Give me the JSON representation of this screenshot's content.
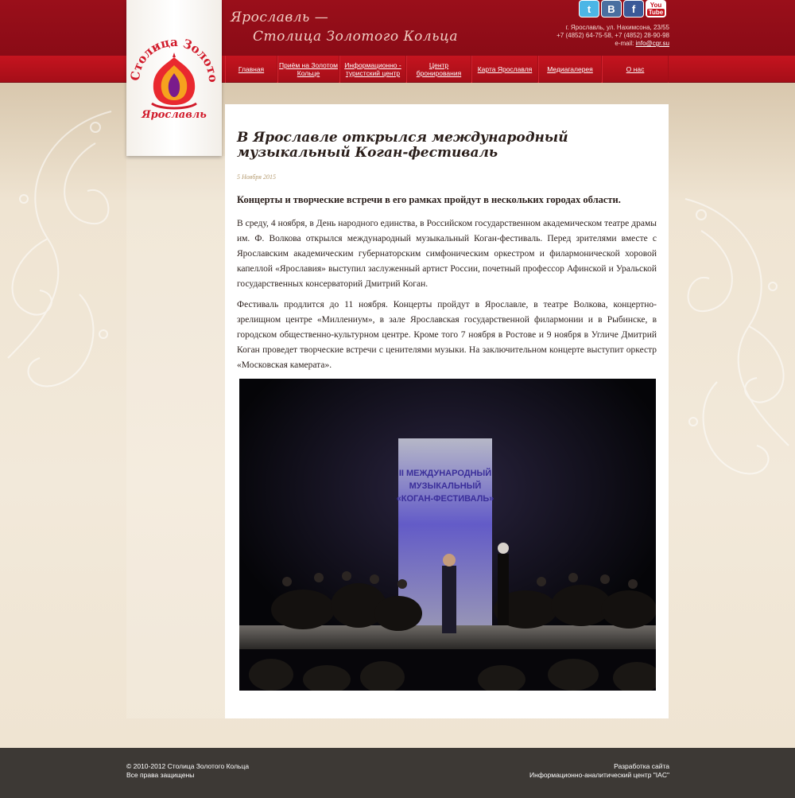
{
  "header": {
    "logo_text_top": "Столица Золотого Кольца",
    "logo_text_bottom": "Ярославль",
    "slogan_line1": "Ярославль —",
    "slogan_line2": "Столица Золотого Кольца",
    "social": [
      {
        "name": "twitter",
        "glyph": "t"
      },
      {
        "name": "vkontakte",
        "glyph": "B"
      },
      {
        "name": "facebook",
        "glyph": "f"
      },
      {
        "name": "youtube",
        "glyph_top": "You",
        "glyph_bottom": "Tube"
      }
    ],
    "address": "г. Ярославль, ул. Нахимсона, 23/55",
    "phones": "+7 (4852) 64-75-58, +7 (4852) 28-90-98",
    "email_label": "e-mail:",
    "email": "info@cgr.su"
  },
  "nav": {
    "items": [
      {
        "label": "Главная",
        "width": 0
      },
      {
        "label": "Приём на Золотом Кольце"
      },
      {
        "label": "Информационно - туристский центр"
      },
      {
        "label": "Центр бронирования"
      },
      {
        "label": "Карта Ярославля"
      },
      {
        "label": "Медиагалерея"
      },
      {
        "label": "О нас"
      }
    ]
  },
  "article": {
    "title": "В Ярославле открылся международный музыкальный Коган-фестиваль",
    "date": "5 Ноября 2015",
    "lead": "Концерты и творческие встречи в его рамках пройдут в нескольких городах области.",
    "paragraph1": "В среду, 4 ноября, в День народного единства, в Российском государственном академическом театре драмы им. Ф. Волкова открылся международный музыкальный Коган-фестиваль. Перед зрителями вместе с Ярославским академическим губернаторским симфоническим оркестром и филармонической хоровой капеллой «Ярославия» выступил заслуженный артист России, почетный профессор Афинской и Уральской государственных консерваторий Дмитрий Коган.",
    "paragraph2": "Фестиваль продлится до 11 ноября. Концерты пройдут в Ярославле, в театре Волкова, концертно-зрелищном центре «Миллениум», в зале Ярославская государственной филармонии и в Рыбинске, в городском общественно-культурном центре. Кроме того 7 ноября в Ростове и 9 ноября в Угличе Дмитрий Коган проведет творческие встречи с ценителями музыки. На заключительном концерте выступит оркестр «Московская камерата».",
    "photo_banner_line1": "II МЕЖДУНАРОДНЫЙ",
    "photo_banner_line2": "МУЗЫКАЛЬНЫЙ",
    "photo_banner_line3": "«КОГАН-ФЕСТИВАЛЬ»"
  },
  "footer": {
    "copyright": "© 2010-2012 Столица Золотого Кольца",
    "rights": "Все права защищены",
    "dev_label": "Разработка сайта",
    "dev_name": "Информационно-аналитический центр \"IAC\""
  },
  "colors": {
    "header_dark": "#9a0f1a",
    "nav_red": "#c5141f",
    "background": "#efe4d2",
    "footer": "#3d3935"
  }
}
